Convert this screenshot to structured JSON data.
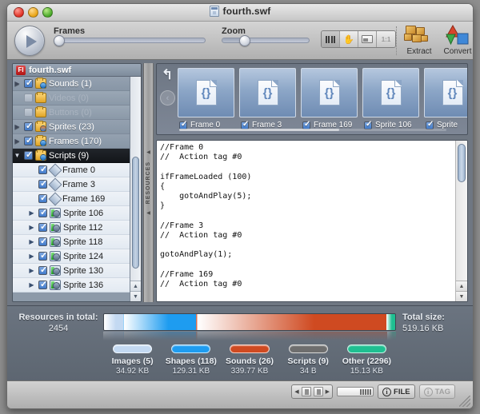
{
  "window": {
    "title": "fourth.swf",
    "controls": {
      "close": "close",
      "minimize": "minimize",
      "zoom": "zoom"
    }
  },
  "toolbar": {
    "play_label": "play",
    "frames_label": "Frames",
    "zoom_label": "Zoom",
    "view_modes": [
      {
        "name": "filmstrip-view",
        "icon": "bars-icon",
        "active": true
      },
      {
        "name": "hand-tool",
        "icon": "hand-icon",
        "active": false
      },
      {
        "name": "preview-view",
        "icon": "image-icon",
        "active": false
      },
      {
        "name": "actual-size",
        "icon": "1:1",
        "label": "1:1",
        "active": false
      }
    ],
    "extract_label": "Extract",
    "convert_label": "Convert"
  },
  "sidebar": {
    "header": {
      "badge": "Fl",
      "title": "fourth.swf"
    },
    "rows": [
      {
        "label": "Sounds (1)",
        "twisty": "▶",
        "checked": true,
        "dim": false,
        "icon": "folder-blue-icon",
        "child": false
      },
      {
        "label": "Videos (0)",
        "twisty": "",
        "checked": false,
        "dim": true,
        "icon": "folder-icon",
        "child": false
      },
      {
        "label": "Buttons (0)",
        "twisty": "",
        "checked": false,
        "dim": true,
        "icon": "folder-icon",
        "child": false
      },
      {
        "label": "Sprites (23)",
        "twisty": "▶",
        "checked": true,
        "dim": false,
        "icon": "folder-multi-icon",
        "child": false
      },
      {
        "label": "Frames (170)",
        "twisty": "▶",
        "checked": true,
        "dim": false,
        "icon": "folder-frame-icon",
        "child": false
      },
      {
        "label": "Scripts (9)",
        "twisty": "▼",
        "checked": true,
        "dim": false,
        "icon": "folder-script-icon",
        "child": false,
        "selected": true
      },
      {
        "label": "Frame 0",
        "twisty": "",
        "checked": true,
        "dim": false,
        "icon": "diamond-icon",
        "child": true
      },
      {
        "label": "Frame 3",
        "twisty": "",
        "checked": true,
        "dim": false,
        "icon": "diamond-icon",
        "child": true
      },
      {
        "label": "Frame 169",
        "twisty": "",
        "checked": true,
        "dim": false,
        "icon": "diamond-icon",
        "child": true
      },
      {
        "label": "Sprite 106",
        "twisty": "▶",
        "checked": true,
        "dim": false,
        "icon": "script-icon",
        "child": true
      },
      {
        "label": "Sprite 112",
        "twisty": "▶",
        "checked": true,
        "dim": false,
        "icon": "script-icon",
        "child": true
      },
      {
        "label": "Sprite 118",
        "twisty": "▶",
        "checked": true,
        "dim": false,
        "icon": "script-icon",
        "child": true
      },
      {
        "label": "Sprite 124",
        "twisty": "▶",
        "checked": true,
        "dim": false,
        "icon": "script-icon",
        "child": true
      },
      {
        "label": "Sprite 130",
        "twisty": "▶",
        "checked": true,
        "dim": false,
        "icon": "script-icon",
        "child": true
      },
      {
        "label": "Sprite 136",
        "twisty": "▶",
        "checked": true,
        "dim": false,
        "icon": "script-icon",
        "child": true
      }
    ]
  },
  "splitter": {
    "label": "RESOURCES"
  },
  "thumbstrip": {
    "undo_icon": "undo-arrow-icon",
    "prev_label": "‹",
    "next_label": "›",
    "items": [
      {
        "label": "Frame 0",
        "checked": true
      },
      {
        "label": "Frame 3",
        "checked": true
      },
      {
        "label": "Frame 169",
        "checked": true
      },
      {
        "label": "Sprite 106",
        "checked": true
      },
      {
        "label": "Sprite",
        "checked": true
      }
    ]
  },
  "code": {
    "text": "//Frame 0\n//  Action tag #0\n\nifFrameLoaded (100)\n{\n    gotoAndPlay(5);\n}\n\n//Frame 3\n//  Action tag #0\n\ngotoAndPlay(1);\n\n//Frame 169\n//  Action tag #0\n"
  },
  "summary": {
    "resources_label": "Resources in total:",
    "resources_count": "2454",
    "total_size_label": "Total size:",
    "total_size_value": "519.16 KB",
    "legend": [
      {
        "name": "Images",
        "label": "Images (5)",
        "size": "34.92 KB",
        "color": "#c3d9f2",
        "percent": 6.7
      },
      {
        "name": "Shapes",
        "label": "Shapes (118)",
        "size": "129.31 KB",
        "color": "#1e9cf0",
        "percent": 24.9
      },
      {
        "name": "Sounds",
        "label": "Sounds (26)",
        "size": "339.77 KB",
        "color": "#cf4a21",
        "percent": 65.4
      },
      {
        "name": "Scripts",
        "label": "Scripts (9)",
        "size": "34 B",
        "color": "#6e6e6e",
        "percent": 0.1
      },
      {
        "name": "Other",
        "label": "Other (2296)",
        "size": "15.13 KB",
        "color": "#1fbf91",
        "percent": 2.9
      }
    ]
  },
  "bottombar": {
    "file_button": "FILE",
    "tag_button": "TAG",
    "info_glyph": "i"
  },
  "chart_data": {
    "type": "bar",
    "title": "Resource size breakdown",
    "categories": [
      "Images (5)",
      "Shapes (118)",
      "Sounds (26)",
      "Scripts (9)",
      "Other (2296)"
    ],
    "values": [
      34.92,
      129.31,
      339.77,
      0.034,
      15.13
    ],
    "value_labels": [
      "34.92 KB",
      "129.31 KB",
      "339.77 KB",
      "34 B",
      "15.13 KB"
    ],
    "counts": [
      5,
      118,
      26,
      9,
      2296
    ],
    "colors": [
      "#c3d9f2",
      "#1e9cf0",
      "#cf4a21",
      "#6e6e6e",
      "#1fbf91"
    ],
    "total": 519.16,
    "total_label": "519.16 KB",
    "total_count": 2454,
    "ylabel": "KB",
    "legend_position": "bottom"
  }
}
